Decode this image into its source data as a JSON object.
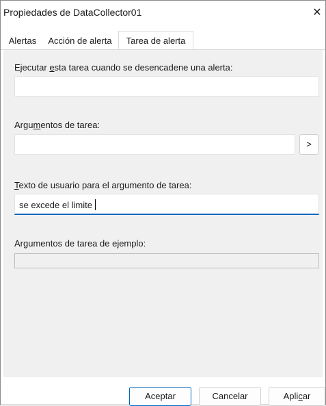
{
  "window": {
    "title": "Propiedades de DataCollector01",
    "close_glyph": "✕"
  },
  "tabs": [
    {
      "label": "Alertas",
      "active": false
    },
    {
      "label": "Acción de alerta",
      "active": false
    },
    {
      "label": "Tarea de alerta",
      "active": true
    }
  ],
  "form": {
    "run_task": {
      "label_pre": "Ejecutar ",
      "label_u": "e",
      "label_post": "sta tarea cuando se desencadene una alerta:",
      "value": ""
    },
    "task_args": {
      "label_pre": "Argu",
      "label_u": "m",
      "label_post": "entos de tarea:",
      "value": "",
      "expand_button": ">"
    },
    "user_text": {
      "label_pre": "",
      "label_u": "T",
      "label_post": "exto de usuario para el argumento de tarea:",
      "value": "se excede el limite"
    },
    "sample_args": {
      "label": "Argumentos de tarea de ejemplo:",
      "value": ""
    }
  },
  "buttons": {
    "ok": "Aceptar",
    "cancel": "Cancelar",
    "apply_pre": "Apli",
    "apply_u": "c",
    "apply_post": "ar"
  },
  "colors": {
    "accent": "#0067c0",
    "panel_bg": "#f0f0f0"
  }
}
